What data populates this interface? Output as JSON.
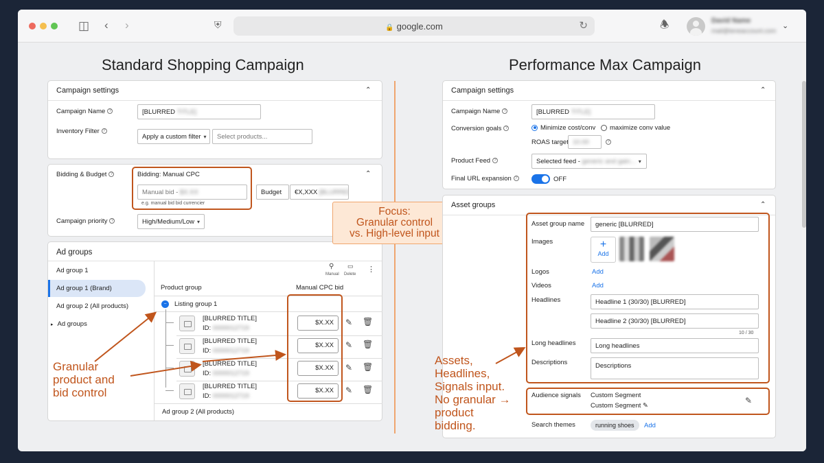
{
  "browser": {
    "url": "google.com",
    "account_name": "David Name",
    "account_email": "mail@teneaccount.com"
  },
  "left": {
    "heading": "Standard Shopping Campaign",
    "campaign_settings": {
      "title": "Campaign settings",
      "campaign_name_label": "Campaign Name",
      "campaign_name_value": "[BLURRED",
      "campaign_name_blur": "TITLE]",
      "inventory_filter_label": "Inventory Filter",
      "filter_select": "Apply a custom filter",
      "filter_placeholder": "Select products..."
    },
    "bidding": {
      "title": "Bidding & Budget",
      "strategy": "Bidding: Manual CPC",
      "manual_bid_label": "Manual bid -",
      "manual_bid_blur": "$X.XX",
      "manual_bid_hint": "e.g. manual bid bid currencier",
      "budget_label": "Budget",
      "budget_value": "€X,XXX",
      "budget_blur": "[BLURRED]",
      "priority_label": "Campaign priority",
      "priority_value": "High/Medium/Low"
    },
    "ad_groups": {
      "title": "Ad groups",
      "sidebar": [
        "Ad group 1",
        "Ad group 1 (Brand)",
        "Ad group 2 (All products)",
        "Ad groups"
      ],
      "toolbar_manual": "Manual",
      "toolbar_delete": "Delete",
      "col_product_group": "Product group",
      "col_bid": "Manual CPC bid",
      "listing_group": "Listing group 1",
      "products": [
        {
          "title": "[BLURRED TITLE]",
          "id_label": "ID:",
          "id_blur": "0000012719",
          "bid": "$X.XX"
        },
        {
          "title": "[BLURRED TITLE]",
          "id_label": "ID:",
          "id_blur": "0000012719",
          "bid": "$X.XX"
        },
        {
          "title": "[BLURRED TITLE]",
          "id_label": "ID:",
          "id_blur": "0000012719",
          "bid": "$X.XX"
        },
        {
          "title": "[BLURRED TITLE]",
          "id_label": "ID:",
          "id_blur": "0000012719",
          "bid": "$X.XX"
        }
      ],
      "footer_group": "Ad group 2 (All products)"
    },
    "annotation": [
      "Granular",
      "product and",
      "bid control"
    ]
  },
  "focus": [
    "Focus:",
    "Granular control",
    "vs. High-level input"
  ],
  "right": {
    "heading": "Performance Max Campaign",
    "campaign_settings": {
      "title": "Campaign settings",
      "campaign_name_label": "Campaign Name",
      "campaign_name_value": "[BLURRED",
      "campaign_name_blur": "TITLE]",
      "conversion_label": "Conversion goals",
      "option_min": "Minimize cost/conv",
      "option_max": "maximize conv value",
      "roas_label": "ROAS target:",
      "roas_blur": "10.00",
      "feed_label": "Product Feed",
      "feed_value": "Selected feed -",
      "feed_blur": "generic and gain...",
      "url_label": "Final URL expansion",
      "url_value": "OFF"
    },
    "asset_groups": {
      "title": "Asset groups",
      "name_label": "Asset group name",
      "name_value": "generic [BLURRED]",
      "images_label": "Images",
      "add_label": "Add",
      "logos_label": "Logos",
      "videos_label": "Videos",
      "headlines_label": "Headlines",
      "headline_1": "Headline 1 (30/30) [BLURRED]",
      "headline_2": "Headline 2 (30/30) [BLURRED]",
      "headline_counter": "10 / 30",
      "long_label": "Long headlines",
      "long_value": "Long headlines",
      "desc_label": "Descriptions",
      "desc_value": "Descriptions",
      "audience_label": "Audience signals",
      "segment_1": "Custom Segment",
      "segment_2": "Custom Segment",
      "search_label": "Search themes",
      "search_chip": "running shoes"
    },
    "annotation": [
      "Assets,",
      "Headlines,",
      "Signals input.",
      "No granular",
      "product",
      "bidding."
    ]
  },
  "colors": {
    "accent_orange": "#c0551c",
    "google_blue": "#1a73e8",
    "page_bg": "#1b2537"
  }
}
